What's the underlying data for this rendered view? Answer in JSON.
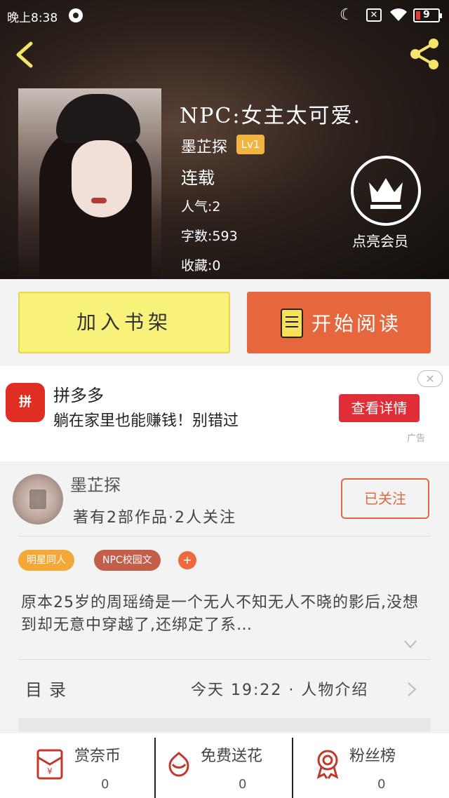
{
  "status_bar": {
    "time": "晚上8:38",
    "battery": "9"
  },
  "book": {
    "title": "NPC:女主太可爱.",
    "author": "墨芷探",
    "level": "Lv1",
    "status": "连载",
    "popularity": "人气:2",
    "word_count": "字数:593",
    "favorites": "收藏:0",
    "vip_label": "点亮会员"
  },
  "actions": {
    "add_shelf": "加入书架",
    "start_read": "开始阅读"
  },
  "ad": {
    "app_name": "拼多多",
    "logo_text": "拼",
    "slogan": "躺在家里也能赚钱！别错过",
    "cta": "查看详情",
    "tag": "广告",
    "close": "×"
  },
  "author_card": {
    "name": "墨芷探",
    "works": "著有2部作品·2人关注",
    "follow": "已关注"
  },
  "tags": [
    "明星同人",
    "NPC校园文"
  ],
  "tag_add": "+",
  "synopsis": "原本25岁的周瑶绮是一个无人不知无人不晓的影后,没想到却无意中穿越了,还绑定了系…",
  "toc": {
    "label": "目录",
    "info": "今天 19:22 · 人物介绍"
  },
  "bottom": [
    {
      "label": "赏奈币",
      "count": "0"
    },
    {
      "label": "免费送花",
      "count": "0"
    },
    {
      "label": "粉丝榜",
      "count": "0"
    }
  ],
  "colors": {
    "accent": "#e6673e",
    "shelf": "#f8f27a",
    "badge": "#f3b542",
    "ad_red": "#e02e24"
  }
}
